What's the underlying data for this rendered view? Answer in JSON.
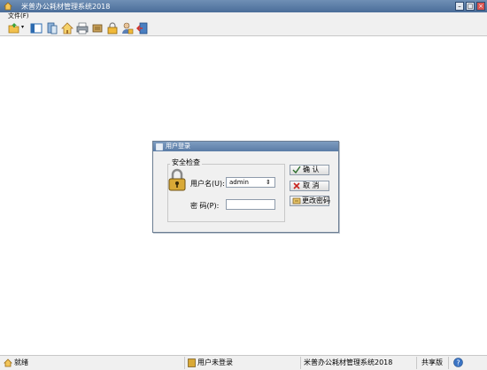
{
  "window": {
    "title": "米普办公耗材管理系统2018",
    "buttons": {
      "minimize": "–",
      "maximize": "□",
      "close": "×"
    }
  },
  "menu": {
    "file": "文件(F)"
  },
  "toolbar": {
    "icons": [
      "open-folder-icon",
      "list-view-icon",
      "data-icon",
      "home-icon",
      "printer-icon",
      "tools-icon",
      "lock-icon",
      "user-lock-icon",
      "exit-icon"
    ]
  },
  "login_dialog": {
    "title": "用户登录",
    "group_title": "安全检查",
    "username_label": "用户名(U):",
    "username_value": "admin",
    "password_label": "密    码(P):",
    "password_value": "",
    "confirm_button": "确 认",
    "cancel_button": "取 消",
    "change_password_button": "更改密码"
  },
  "statusbar": {
    "status": "就绪",
    "user": "用户未登录",
    "app_name": "米普办公耗材管理系统2018",
    "edition": "共享版"
  }
}
